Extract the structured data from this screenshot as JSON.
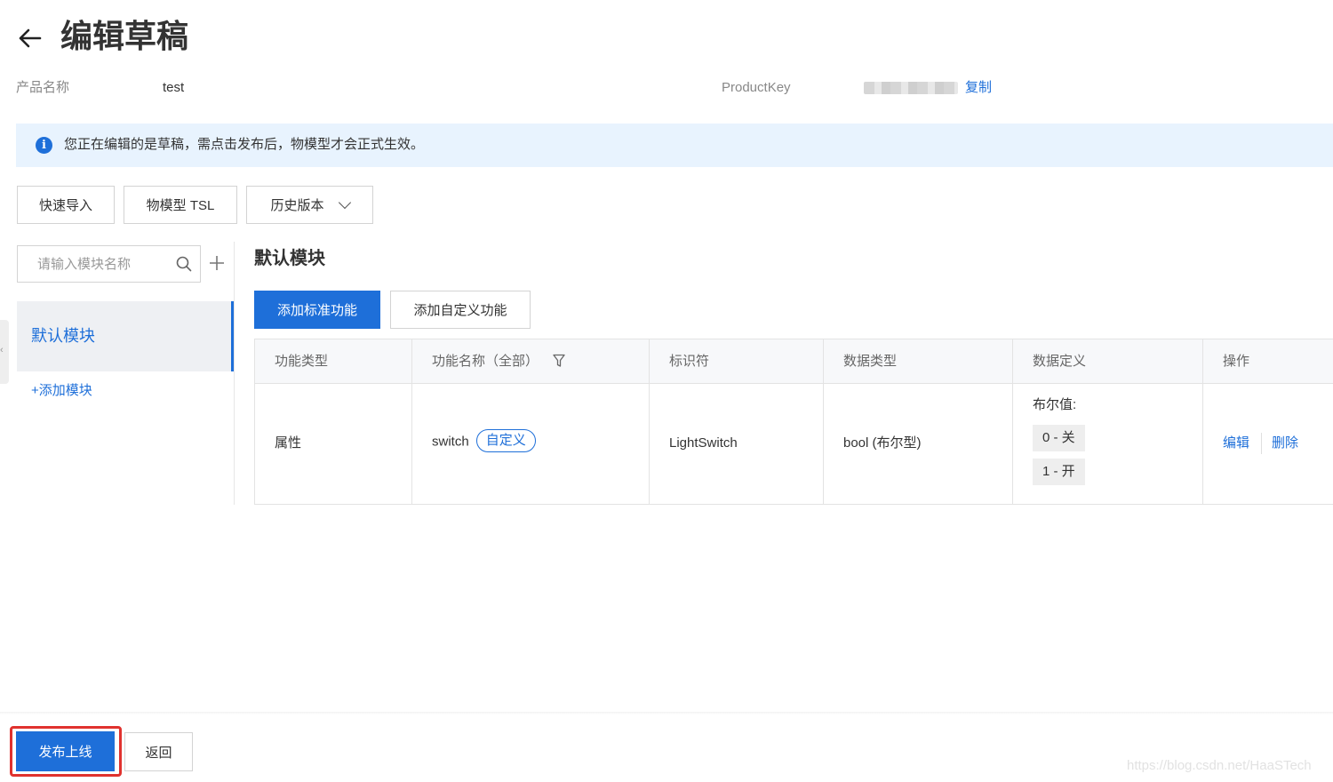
{
  "header": {
    "title": "编辑草稿",
    "back_icon": "arrow-left-icon"
  },
  "meta": {
    "product_name_label": "产品名称",
    "product_name_value": "test",
    "product_key_label": "ProductKey",
    "copy_label": "复制"
  },
  "notice": {
    "icon": "info-icon",
    "text": "您正在编辑的是草稿，需点击发布后，物模型才会正式生效。"
  },
  "toolbar": {
    "quick_import": "快速导入",
    "tsl": "物模型 TSL",
    "history": "历史版本"
  },
  "sidebar": {
    "search_placeholder": "请输入模块名称",
    "active_module": "默认模块",
    "add_module": "+添加模块"
  },
  "main": {
    "section_title": "默认模块",
    "add_standard": "添加标准功能",
    "add_custom": "添加自定义功能"
  },
  "table": {
    "columns": [
      "功能类型",
      "功能名称（全部）",
      "标识符",
      "数据类型",
      "数据定义",
      "操作"
    ],
    "rows": [
      {
        "type": "属性",
        "name": "switch",
        "tag": "自定义",
        "identifier": "LightSwitch",
        "data_type": "bool (布尔型)",
        "definition_title": "布尔值:",
        "definition_values": [
          "0 - 关",
          "1 - 开"
        ],
        "actions": [
          "编辑",
          "删除"
        ]
      }
    ]
  },
  "footer": {
    "publish": "发布上线",
    "back": "返回"
  },
  "watermark": "https://blog.csdn.net/HaaSTech",
  "colors": {
    "accent": "#1e6fd9",
    "notice_bg": "#e8f3fe",
    "highlight_outline": "#e0322e"
  }
}
